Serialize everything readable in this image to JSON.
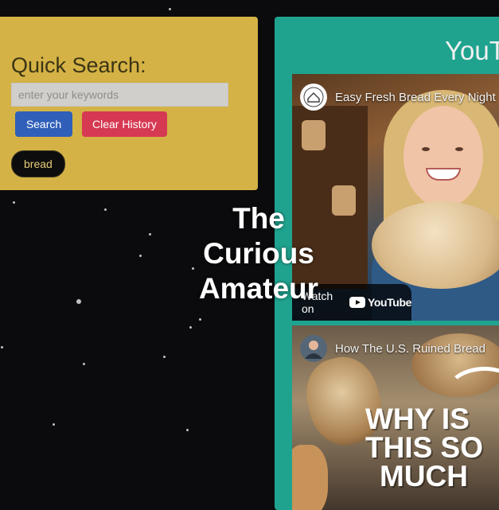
{
  "quick_search": {
    "title": "Quick Search:",
    "input_placeholder": "enter your keywords",
    "input_value": "",
    "search_label": "Search",
    "clear_label": "Clear History",
    "history": [
      "bread"
    ]
  },
  "site": {
    "title_line1": "The",
    "title_line2": "Curious",
    "title_line3": "Amateur"
  },
  "youtube": {
    "heading": "YouTube",
    "videos": [
      {
        "title": "Easy Fresh Bread Every Night",
        "watch_on": "Watch on",
        "brand": "YouTube",
        "avatar_icon": "channel-logo-icon"
      },
      {
        "title": "How The U.S. Ruined Bread",
        "overlay_line1": "WHY IS",
        "overlay_line2": "THIS SO",
        "overlay_line3": "MUCH",
        "avatar_icon": "channel-avatar-icon"
      }
    ]
  },
  "colors": {
    "background": "#0b0a0d",
    "search_card": "#d4b245",
    "search_button": "#2f5fb8",
    "clear_button": "#d63952",
    "youtube_panel": "#1fa38f"
  }
}
